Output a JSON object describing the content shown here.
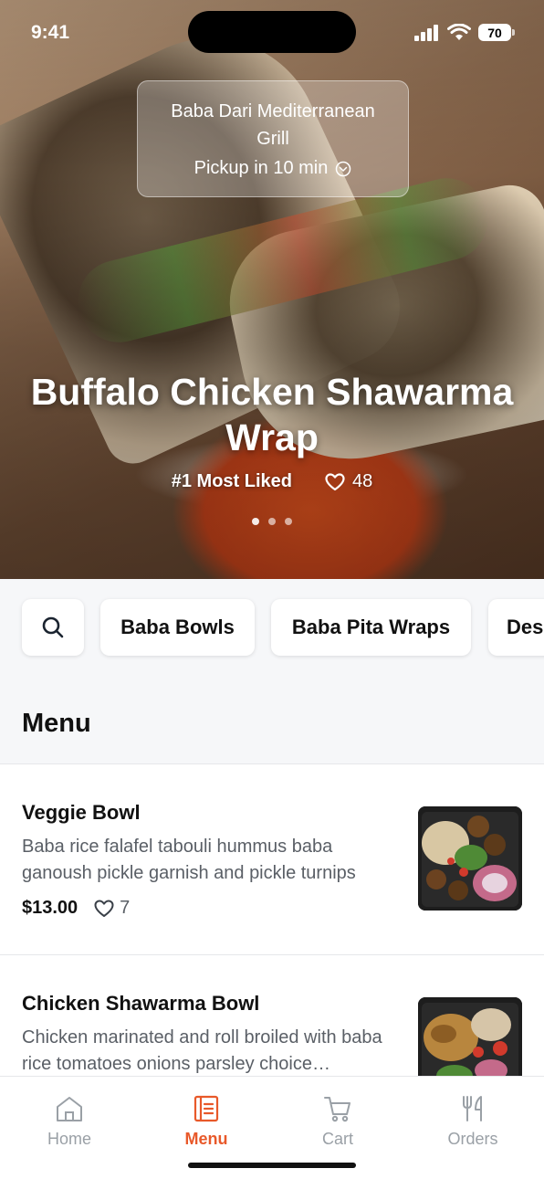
{
  "status_bar": {
    "time": "9:41",
    "battery": "70"
  },
  "store": {
    "name": "Baba Dari Mediterranean Grill",
    "pickup": "Pickup in 10 min"
  },
  "hero": {
    "title": "Buffalo Chicken Shawarma Wrap",
    "badge": "#1 Most Liked",
    "likes": "48"
  },
  "categories": {
    "items": [
      "Baba Bowls",
      "Baba Pita Wraps",
      "Des"
    ]
  },
  "menu": {
    "heading": "Menu",
    "items": [
      {
        "name": "Veggie Bowl",
        "description": "Baba rice falafel tabouli hummus baba ganoush pickle garnish and pickle turnips",
        "price": "$13.00",
        "likes": "7"
      },
      {
        "name": "Chicken Shawarma Bowl",
        "description": "Chicken marinated and roll broiled with baba rice tomatoes onions parsley choice…"
      }
    ]
  },
  "tabbar": {
    "home": "Home",
    "menu": "Menu",
    "cart": "Cart",
    "orders": "Orders"
  },
  "colors": {
    "accent": "#e8592a"
  }
}
